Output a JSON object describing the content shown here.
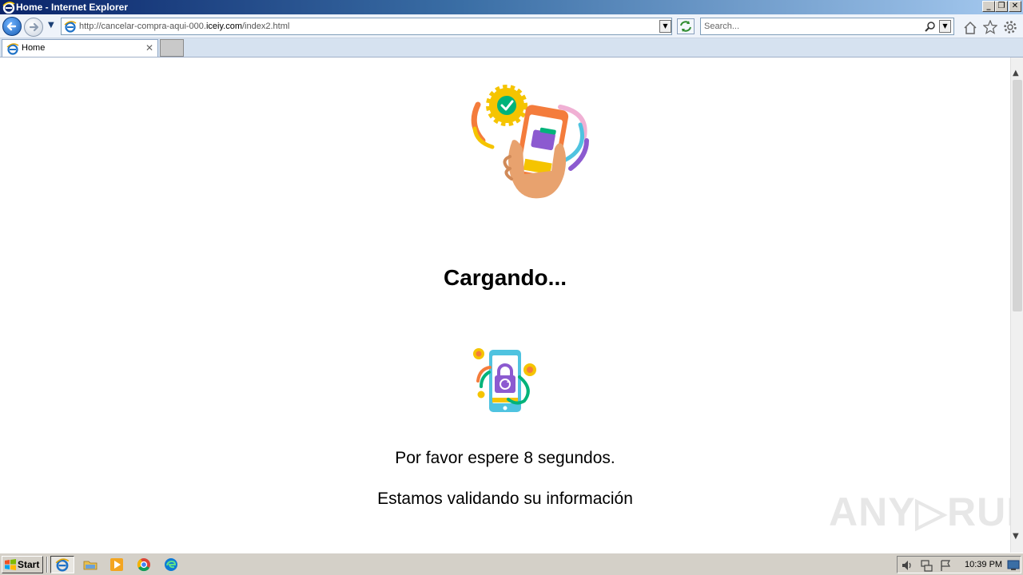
{
  "window": {
    "title": "Home - Internet Explorer",
    "buttons": {
      "minimize": "_",
      "restore": "❐",
      "close": "✕"
    }
  },
  "navbar": {
    "address": {
      "prefix": "http://cancelar-compra-aqui-000.",
      "domain": "iceiy.com",
      "suffix": "/index2.html"
    },
    "search_placeholder": "Search..."
  },
  "tabs": [
    {
      "label": "Home",
      "close": "✕"
    }
  ],
  "page": {
    "heading": "Cargando...",
    "wait_message": "Por favor espere 8 segundos.",
    "validating_message": "Estamos validando su información"
  },
  "watermark": "ANY▷RUN",
  "taskbar": {
    "start_label": "Start",
    "clock": "10:39 PM"
  },
  "colors": {
    "title_start": "#0a246a",
    "title_end": "#a6caf0",
    "taskbar": "#d4d0c8",
    "ie_blue": "#1f72c6"
  },
  "icons": {
    "back": "back-arrow-icon",
    "forward": "forward-arrow-icon",
    "home": "home-icon",
    "favorites": "star-icon",
    "tools": "gear-icon"
  }
}
